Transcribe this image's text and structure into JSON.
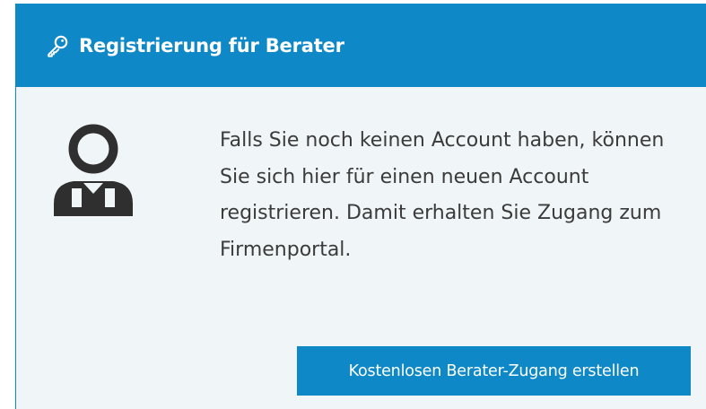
{
  "header": {
    "title": "Registrierung für Berater",
    "icon": "key-icon"
  },
  "body": {
    "icon": "advisor-icon",
    "text": "Falls Sie noch keinen Account haben, können Sie sich hier für einen neuen Account registrieren. Damit erhalten Sie Zugang zum Firmenportal."
  },
  "actions": {
    "create_account_label": "Kostenlosen Berater-Zugang erstellen"
  },
  "colors": {
    "accent": "#0e88c6",
    "panel_background": "#f0f5f8",
    "text": "#3b3b3b",
    "icon": "#2f2f2f"
  }
}
